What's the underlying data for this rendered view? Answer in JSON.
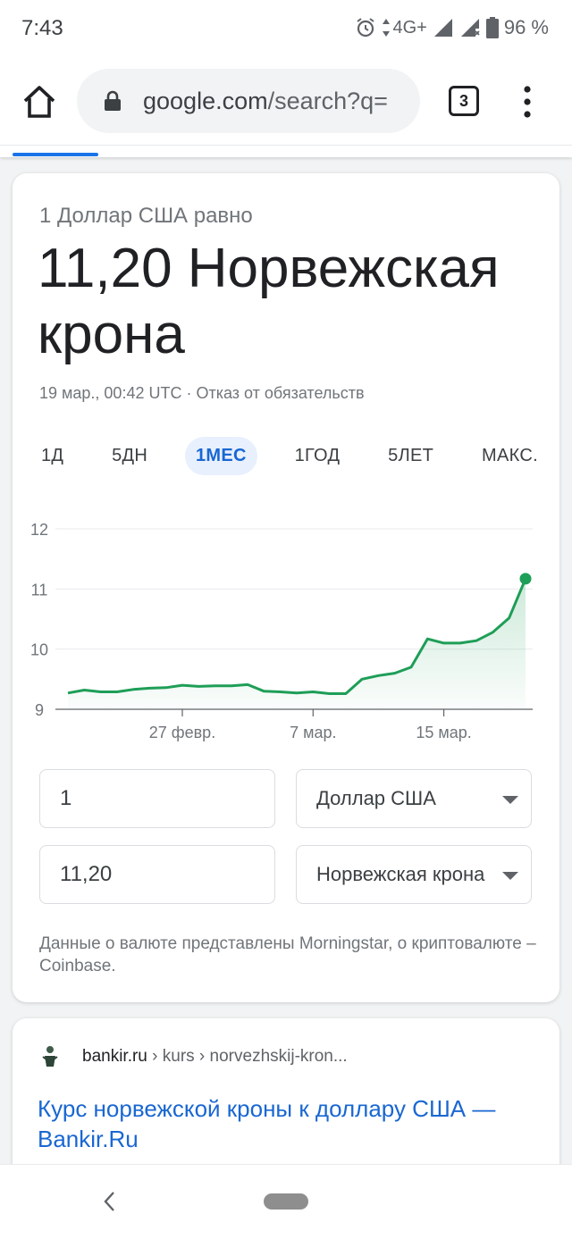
{
  "status_bar": {
    "time": "7:43",
    "network": "4G+",
    "battery": "96 %"
  },
  "browser": {
    "url_host": "google.com",
    "url_rest": "/search?q=",
    "tab_count": "3"
  },
  "converter": {
    "subtitle": "1 Доллар США равно",
    "result": "11,20 Норвежская крона",
    "timestamp": "19 мар., 00:42 UTC · Отказ от обязательств",
    "ranges": [
      {
        "label": "1Д",
        "active": false
      },
      {
        "label": "5ДН",
        "active": false
      },
      {
        "label": "1МЕС",
        "active": true
      },
      {
        "label": "1ГОД",
        "active": false
      },
      {
        "label": "5ЛЕТ",
        "active": false
      },
      {
        "label": "МАКС.",
        "active": false
      }
    ],
    "amount_from": "1",
    "currency_from": "Доллар США",
    "amount_to": "11,20",
    "currency_to": "Норвежская крона",
    "attribution": "Данные о валюте представлены Morningstar, о криптовалюте – Coinbase."
  },
  "chart_data": {
    "type": "area",
    "ylim": [
      9,
      12
    ],
    "yticks": [
      "9",
      "10",
      "11",
      "12"
    ],
    "xticks": [
      {
        "label": "27 февр.",
        "index": 7
      },
      {
        "label": "7 мар.",
        "index": 15
      },
      {
        "label": "15 мар.",
        "index": 23
      }
    ],
    "values": [
      9.27,
      9.32,
      9.29,
      9.29,
      9.33,
      9.35,
      9.36,
      9.4,
      9.38,
      9.39,
      9.39,
      9.41,
      9.3,
      9.29,
      9.27,
      9.29,
      9.26,
      9.26,
      9.5,
      9.56,
      9.6,
      9.7,
      10.17,
      10.1,
      10.1,
      10.14,
      10.28,
      10.52,
      11.17
    ],
    "line_color": "#1e9e57",
    "grid": true
  },
  "search_result": {
    "site": "bankir.ru",
    "path": " › kurs › norvezhskij-kron...",
    "title": "Курс норвежской кроны к доллару США — Bankir.Ru"
  }
}
